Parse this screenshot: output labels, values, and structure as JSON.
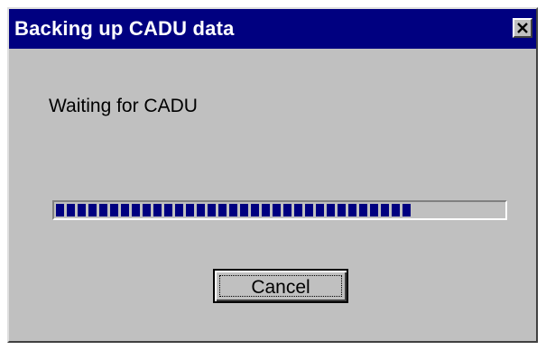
{
  "window": {
    "title": "Backing up CADU data",
    "close_icon": "close-icon"
  },
  "status": {
    "message": "Waiting for CADU"
  },
  "progress": {
    "fraction": 0.8,
    "fill_color": "#000080"
  },
  "buttons": {
    "cancel_label": "Cancel"
  },
  "colors": {
    "titlebar": "#000080",
    "dialog_face": "#c0c0c0"
  }
}
